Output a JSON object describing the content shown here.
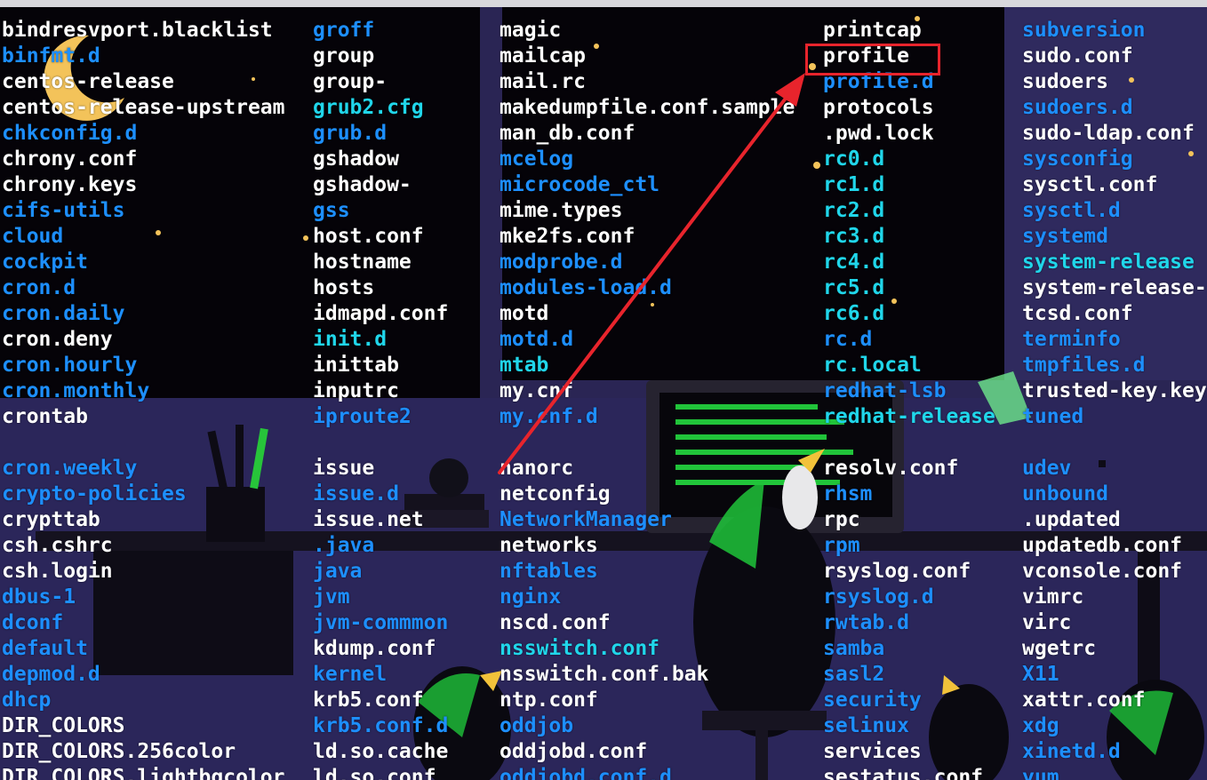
{
  "terminal": {
    "columns": [
      {
        "items": [
          {
            "name": "bindresvport.blacklist",
            "kind": "file"
          },
          {
            "name": "binfmt.d",
            "kind": "dir"
          },
          {
            "name": "centos-release",
            "kind": "file"
          },
          {
            "name": "centos-release-upstream",
            "kind": "file"
          },
          {
            "name": "chkconfig.d",
            "kind": "dir"
          },
          {
            "name": "chrony.conf",
            "kind": "file"
          },
          {
            "name": "chrony.keys",
            "kind": "file"
          },
          {
            "name": "cifs-utils",
            "kind": "dir"
          },
          {
            "name": "cloud",
            "kind": "dir"
          },
          {
            "name": "cockpit",
            "kind": "dir"
          },
          {
            "name": "cron.d",
            "kind": "dir"
          },
          {
            "name": "cron.daily",
            "kind": "dir"
          },
          {
            "name": "cron.deny",
            "kind": "file"
          },
          {
            "name": "cron.hourly",
            "kind": "dir"
          },
          {
            "name": "cron.monthly",
            "kind": "dir"
          },
          {
            "name": "crontab",
            "kind": "file"
          },
          {
            "name": "",
            "kind": "blank"
          },
          {
            "name": "cron.weekly",
            "kind": "dir"
          },
          {
            "name": "crypto-policies",
            "kind": "dir"
          },
          {
            "name": "crypttab",
            "kind": "file"
          },
          {
            "name": "csh.cshrc",
            "kind": "file"
          },
          {
            "name": "csh.login",
            "kind": "file"
          },
          {
            "name": "dbus-1",
            "kind": "dir"
          },
          {
            "name": "dconf",
            "kind": "dir"
          },
          {
            "name": "default",
            "kind": "dir"
          },
          {
            "name": "depmod.d",
            "kind": "dir"
          },
          {
            "name": "dhcp",
            "kind": "dir"
          },
          {
            "name": "DIR_COLORS",
            "kind": "file"
          },
          {
            "name": "DIR_COLORS.256color",
            "kind": "file"
          },
          {
            "name": "DIR_COLORS.lightbgcolor",
            "kind": "file"
          }
        ]
      },
      {
        "items": [
          {
            "name": "groff",
            "kind": "dir"
          },
          {
            "name": "group",
            "kind": "file"
          },
          {
            "name": "group-",
            "kind": "file"
          },
          {
            "name": "grub2.cfg",
            "kind": "link"
          },
          {
            "name": "grub.d",
            "kind": "dir"
          },
          {
            "name": "gshadow",
            "kind": "file"
          },
          {
            "name": "gshadow-",
            "kind": "file"
          },
          {
            "name": "gss",
            "kind": "dir"
          },
          {
            "name": "host.conf",
            "kind": "file"
          },
          {
            "name": "hostname",
            "kind": "file"
          },
          {
            "name": "hosts",
            "kind": "file"
          },
          {
            "name": "idmapd.conf",
            "kind": "file"
          },
          {
            "name": "init.d",
            "kind": "link"
          },
          {
            "name": "inittab",
            "kind": "file"
          },
          {
            "name": "inputrc",
            "kind": "file"
          },
          {
            "name": "iproute2",
            "kind": "dir"
          },
          {
            "name": "",
            "kind": "blank"
          },
          {
            "name": "issue",
            "kind": "file"
          },
          {
            "name": "issue.d",
            "kind": "dir"
          },
          {
            "name": "issue.net",
            "kind": "file"
          },
          {
            "name": ".java",
            "kind": "dir"
          },
          {
            "name": "java",
            "kind": "dir"
          },
          {
            "name": "jvm",
            "kind": "dir"
          },
          {
            "name": "jvm-commmon",
            "kind": "dir"
          },
          {
            "name": "kdump.conf",
            "kind": "file"
          },
          {
            "name": "kernel",
            "kind": "dir"
          },
          {
            "name": "krb5.conf",
            "kind": "file"
          },
          {
            "name": "krb5.conf.d",
            "kind": "dir"
          },
          {
            "name": "ld.so.cache",
            "kind": "file"
          },
          {
            "name": "ld.so.conf",
            "kind": "file"
          }
        ]
      },
      {
        "items": [
          {
            "name": "magic",
            "kind": "file"
          },
          {
            "name": "mailcap",
            "kind": "file"
          },
          {
            "name": "mail.rc",
            "kind": "file"
          },
          {
            "name": "makedumpfile.conf.sample",
            "kind": "file"
          },
          {
            "name": "man_db.conf",
            "kind": "file"
          },
          {
            "name": "mcelog",
            "kind": "dir"
          },
          {
            "name": "microcode_ctl",
            "kind": "dir"
          },
          {
            "name": "mime.types",
            "kind": "file"
          },
          {
            "name": "mke2fs.conf",
            "kind": "file"
          },
          {
            "name": "modprobe.d",
            "kind": "dir"
          },
          {
            "name": "modules-load.d",
            "kind": "dir"
          },
          {
            "name": "motd",
            "kind": "file"
          },
          {
            "name": "motd.d",
            "kind": "dir"
          },
          {
            "name": "mtab",
            "kind": "link"
          },
          {
            "name": "my.cnf",
            "kind": "file"
          },
          {
            "name": "my.cnf.d",
            "kind": "dir"
          },
          {
            "name": "",
            "kind": "blank"
          },
          {
            "name": "nanorc",
            "kind": "file"
          },
          {
            "name": "netconfig",
            "kind": "file"
          },
          {
            "name": "NetworkManager",
            "kind": "dir"
          },
          {
            "name": "networks",
            "kind": "file"
          },
          {
            "name": "nftables",
            "kind": "dir"
          },
          {
            "name": "nginx",
            "kind": "dir"
          },
          {
            "name": "nscd.conf",
            "kind": "file"
          },
          {
            "name": "nsswitch.conf",
            "kind": "link"
          },
          {
            "name": "nsswitch.conf.bak",
            "kind": "file"
          },
          {
            "name": "ntp.conf",
            "kind": "file"
          },
          {
            "name": "oddjob",
            "kind": "dir"
          },
          {
            "name": "oddjobd.conf",
            "kind": "file"
          },
          {
            "name": "oddjobd.conf.d",
            "kind": "dir"
          }
        ]
      },
      {
        "items": [
          {
            "name": "printcap",
            "kind": "file"
          },
          {
            "name": "profile",
            "kind": "file"
          },
          {
            "name": "profile.d",
            "kind": "dir"
          },
          {
            "name": "protocols",
            "kind": "file"
          },
          {
            "name": ".pwd.lock",
            "kind": "file"
          },
          {
            "name": "rc0.d",
            "kind": "link"
          },
          {
            "name": "rc1.d",
            "kind": "link"
          },
          {
            "name": "rc2.d",
            "kind": "link"
          },
          {
            "name": "rc3.d",
            "kind": "link"
          },
          {
            "name": "rc4.d",
            "kind": "link"
          },
          {
            "name": "rc5.d",
            "kind": "link"
          },
          {
            "name": "rc6.d",
            "kind": "link"
          },
          {
            "name": "rc.d",
            "kind": "dir"
          },
          {
            "name": "rc.local",
            "kind": "link"
          },
          {
            "name": "redhat-lsb",
            "kind": "dir"
          },
          {
            "name": "redhat-release",
            "kind": "link"
          },
          {
            "name": "",
            "kind": "blank"
          },
          {
            "name": "resolv.conf",
            "kind": "file"
          },
          {
            "name": "rhsm",
            "kind": "dir"
          },
          {
            "name": "rpc",
            "kind": "file"
          },
          {
            "name": "rpm",
            "kind": "dir"
          },
          {
            "name": "rsyslog.conf",
            "kind": "file"
          },
          {
            "name": "rsyslog.d",
            "kind": "dir"
          },
          {
            "name": "rwtab.d",
            "kind": "dir"
          },
          {
            "name": "samba",
            "kind": "dir"
          },
          {
            "name": "sasl2",
            "kind": "dir"
          },
          {
            "name": "security",
            "kind": "dir"
          },
          {
            "name": "selinux",
            "kind": "dir"
          },
          {
            "name": "services",
            "kind": "file"
          },
          {
            "name": "sestatus.conf",
            "kind": "file"
          }
        ]
      },
      {
        "items": [
          {
            "name": "subversion",
            "kind": "dir"
          },
          {
            "name": "sudo.conf",
            "kind": "file"
          },
          {
            "name": "sudoers",
            "kind": "file"
          },
          {
            "name": "sudoers.d",
            "kind": "dir"
          },
          {
            "name": "sudo-ldap.conf",
            "kind": "file"
          },
          {
            "name": "sysconfig",
            "kind": "dir"
          },
          {
            "name": "sysctl.conf",
            "kind": "file"
          },
          {
            "name": "sysctl.d",
            "kind": "dir"
          },
          {
            "name": "systemd",
            "kind": "dir"
          },
          {
            "name": "system-release",
            "kind": "link"
          },
          {
            "name": "system-release-",
            "kind": "file"
          },
          {
            "name": "tcsd.conf",
            "kind": "file"
          },
          {
            "name": "terminfo",
            "kind": "dir"
          },
          {
            "name": "tmpfiles.d",
            "kind": "dir"
          },
          {
            "name": "trusted-key.key",
            "kind": "file"
          },
          {
            "name": "tuned",
            "kind": "dir"
          },
          {
            "name": "",
            "kind": "blank"
          },
          {
            "name": "udev",
            "kind": "dir"
          },
          {
            "name": "unbound",
            "kind": "dir"
          },
          {
            "name": ".updated",
            "kind": "file"
          },
          {
            "name": "updatedb.conf",
            "kind": "file"
          },
          {
            "name": "vconsole.conf",
            "kind": "file"
          },
          {
            "name": "vimrc",
            "kind": "file"
          },
          {
            "name": "virc",
            "kind": "file"
          },
          {
            "name": "wgetrc",
            "kind": "file"
          },
          {
            "name": "X11",
            "kind": "dir"
          },
          {
            "name": "xattr.conf",
            "kind": "file"
          },
          {
            "name": "xdg",
            "kind": "dir"
          },
          {
            "name": "xinetd.d",
            "kind": "dir"
          },
          {
            "name": "yum",
            "kind": "dir"
          }
        ]
      }
    ]
  },
  "colors": {
    "file": "#ffffff",
    "dir": "#1d8fff",
    "link": "#20d6ea",
    "annotation": "#e8242c"
  },
  "annotation": {
    "highlighted_item": "profile",
    "shape": "rectangle-with-arrow"
  }
}
